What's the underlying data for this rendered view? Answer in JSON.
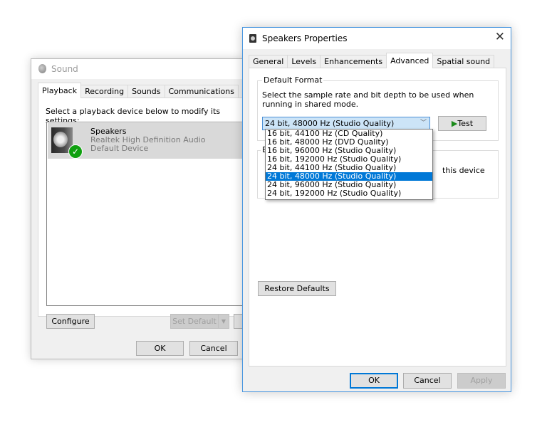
{
  "sound_dialog": {
    "title": "Sound",
    "tabs": [
      {
        "label": "Playback",
        "active": true
      },
      {
        "label": "Recording",
        "active": false
      },
      {
        "label": "Sounds",
        "active": false
      },
      {
        "label": "Communications",
        "active": false
      }
    ],
    "instruction": "Select a playback device below to modify its settings:",
    "devices": [
      {
        "name": "Speakers",
        "driver": "Realtek High Definition Audio",
        "status": "Default Device",
        "selected": true
      }
    ],
    "buttons": {
      "configure": "Configure",
      "set_default": "Set Default",
      "ok": "OK",
      "cancel": "Cancel"
    }
  },
  "properties_dialog": {
    "title": "Speakers Properties",
    "tabs": [
      {
        "label": "General",
        "active": false
      },
      {
        "label": "Levels",
        "active": false
      },
      {
        "label": "Enhancements",
        "active": false
      },
      {
        "label": "Advanced",
        "active": true
      },
      {
        "label": "Spatial sound",
        "active": false
      }
    ],
    "default_format": {
      "group_label": "Default Format",
      "description": "Select the sample rate and bit depth to be used when running in shared mode.",
      "selected_value": "24 bit, 48000 Hz (Studio Quality)",
      "test_label": "Test",
      "options": [
        "16 bit, 44100 Hz (CD Quality)",
        "16 bit, 48000 Hz (DVD Quality)",
        "16 bit, 96000 Hz (Studio Quality)",
        "16 bit, 192000 Hz (Studio Quality)",
        "24 bit, 44100 Hz (Studio Quality)",
        "24 bit, 48000 Hz (Studio Quality)",
        "24 bit, 96000 Hz (Studio Quality)",
        "24 bit, 192000 Hz (Studio Quality)"
      ],
      "highlighted_index": 5
    },
    "exclusive_group_partial": {
      "label_fragment": "E",
      "text_fragment": "this device"
    },
    "buttons": {
      "restore_defaults": "Restore Defaults",
      "ok": "OK",
      "cancel": "Cancel",
      "apply": "Apply"
    }
  }
}
